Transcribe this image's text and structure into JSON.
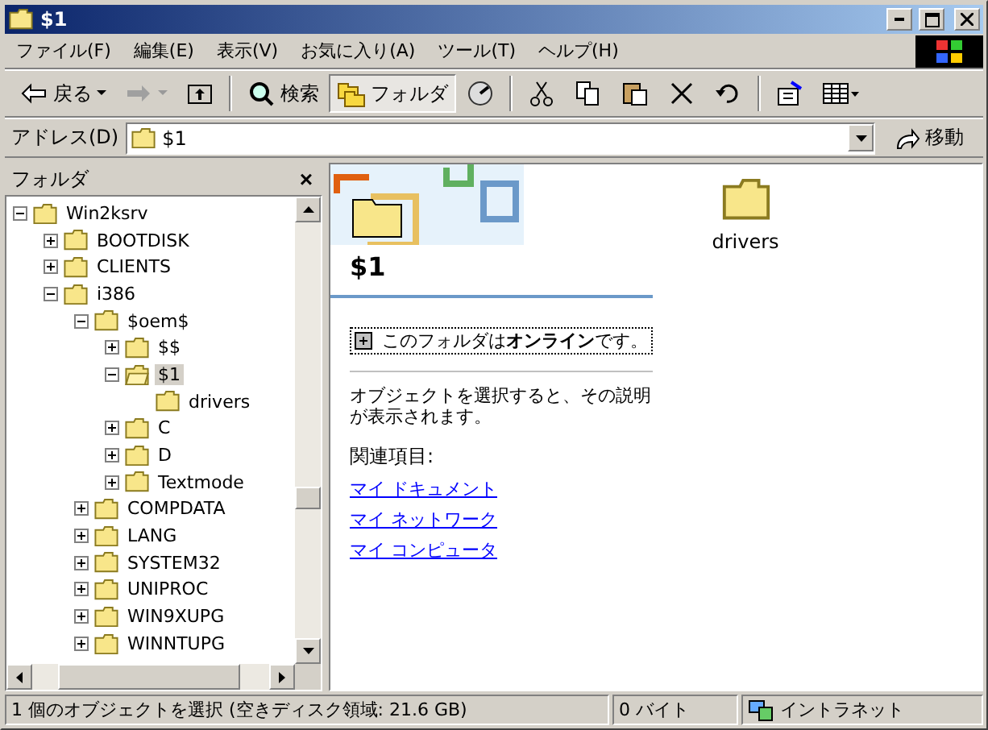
{
  "window": {
    "title": "$1"
  },
  "menu": [
    "ファイル(F)",
    "編集(E)",
    "表示(V)",
    "お気に入り(A)",
    "ツール(T)",
    "ヘルプ(H)"
  ],
  "toolbar": [
    {
      "kind": "back",
      "label": "戻る",
      "selected": false
    },
    {
      "kind": "forward",
      "selected": false
    },
    {
      "kind": "up",
      "selected": false
    },
    {
      "kind": "search",
      "label": "検索",
      "selected": false
    },
    {
      "kind": "folders",
      "label": "フォルダ",
      "selected": true
    },
    {
      "kind": "history",
      "selected": false
    },
    {
      "kind": "cut",
      "selected": false
    },
    {
      "kind": "copy",
      "selected": false
    },
    {
      "kind": "paste",
      "selected": false
    },
    {
      "kind": "delete",
      "selected": false
    },
    {
      "kind": "undo",
      "selected": false
    },
    {
      "kind": "properties",
      "selected": false
    },
    {
      "kind": "views",
      "selected": false
    }
  ],
  "address": {
    "label": "アドレス(D)",
    "value": "$1",
    "go": "移動"
  },
  "folder_pane": {
    "title": "フォルダ",
    "close": "×",
    "tree": [
      {
        "label": "Win2ksrv",
        "expandable": true,
        "expanded": true,
        "selected": false,
        "children": [
          {
            "label": "BOOTDISK",
            "expandable": true,
            "expanded": false,
            "selected": false
          },
          {
            "label": "CLIENTS",
            "expandable": true,
            "expanded": false,
            "selected": false
          },
          {
            "label": "i386",
            "expandable": true,
            "expanded": true,
            "selected": false,
            "children": [
              {
                "label": "$oem$",
                "expandable": true,
                "expanded": true,
                "selected": false,
                "children": [
                  {
                    "label": "$$",
                    "expandable": true,
                    "expanded": false,
                    "selected": false
                  },
                  {
                    "label": "$1",
                    "expandable": true,
                    "expanded": true,
                    "selected": true,
                    "children": [
                      {
                        "label": "drivers",
                        "expandable": false,
                        "expanded": false,
                        "selected": false
                      }
                    ]
                  },
                  {
                    "label": "C",
                    "expandable": true,
                    "expanded": false,
                    "selected": false
                  },
                  {
                    "label": "D",
                    "expandable": true,
                    "expanded": false,
                    "selected": false
                  },
                  {
                    "label": "Textmode",
                    "expandable": true,
                    "expanded": false,
                    "selected": false
                  }
                ]
              },
              {
                "label": "COMPDATA",
                "expandable": true,
                "expanded": false,
                "selected": false
              },
              {
                "label": "LANG",
                "expandable": true,
                "expanded": false,
                "selected": false
              },
              {
                "label": "SYSTEM32",
                "expandable": true,
                "expanded": false,
                "selected": false
              },
              {
                "label": "UNIPROC",
                "expandable": true,
                "expanded": false,
                "selected": false
              },
              {
                "label": "WIN9XUPG",
                "expandable": true,
                "expanded": false,
                "selected": false
              },
              {
                "label": "WINNTUPG",
                "expandable": true,
                "expanded": false,
                "selected": false
              }
            ]
          }
        ]
      }
    ]
  },
  "info_panel": {
    "folder_name": "$1",
    "status": "このフォルダは**オンライン**です。",
    "hint": "オブジェクトを選択すると、その説明が表示されます。",
    "related_label": "関連項目:",
    "links": [
      "マイ ドキュメント",
      "マイ ネットワーク",
      "マイ コンピュータ"
    ]
  },
  "items": [
    {
      "label": "drivers"
    }
  ],
  "status_bar": {
    "selection": "1 個のオブジェクトを選択 (空きディスク領域: 21.6 GB)",
    "size": "0 バイト",
    "zone": "イントラネット"
  }
}
